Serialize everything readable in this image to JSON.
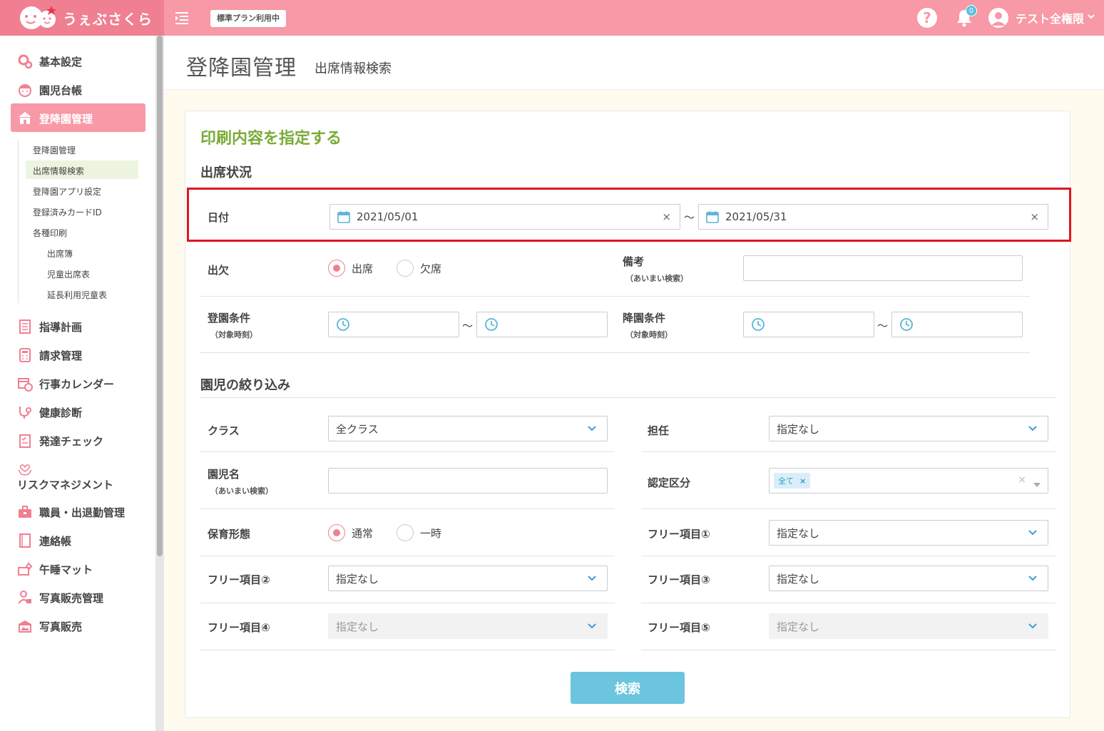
{
  "header": {
    "logo_text": "うぇぶさくら",
    "plan_badge": "標準プラン利用中",
    "help_label": "?",
    "notification_count": "0",
    "user_name": "テスト全権限",
    "brand_color": "#f799a6"
  },
  "sidebar": {
    "items": [
      {
        "label": "基本設定",
        "icon": "gear-icon"
      },
      {
        "label": "園児台帳",
        "icon": "child-face-icon"
      },
      {
        "label": "登降園管理",
        "icon": "school-icon"
      },
      {
        "label": "指導計画",
        "icon": "notebook-icon"
      },
      {
        "label": "請求管理",
        "icon": "calculator-icon"
      },
      {
        "label": "行事カレンダー",
        "icon": "calendar-clock-icon"
      },
      {
        "label": "健康診断",
        "icon": "stethoscope-icon"
      },
      {
        "label": "発達チェック",
        "icon": "checklist-icon"
      },
      {
        "label": "リスクマネジメント",
        "icon": "hands-heart-icon"
      },
      {
        "label": "職員・出退勤管理",
        "icon": "briefcase-icon"
      },
      {
        "label": "連絡帳",
        "icon": "book-icon"
      },
      {
        "label": "午睡マット",
        "icon": "mat-icon"
      },
      {
        "label": "写真販売管理",
        "icon": "person-photo-icon"
      },
      {
        "label": "写真販売",
        "icon": "photo-shop-icon"
      }
    ],
    "sub_items": [
      "登降園管理",
      "出席情報検索",
      "登降園アプリ設定",
      "登録済みカードID",
      "各種印刷"
    ],
    "sub_sub_items": [
      "出席簿",
      "児童出席表",
      "延長利用児童表"
    ]
  },
  "page": {
    "title": "登降園管理",
    "subtitle": "出席情報検索"
  },
  "form": {
    "card_title": "印刷内容を指定する",
    "attendance_section": "出席状況",
    "date_label": "日付",
    "date_from": "2021/05/01",
    "date_to": "2021/05/31",
    "tilde": "～",
    "clear_symbol": "×",
    "presence_label": "出欠",
    "presence_options": [
      "出席",
      "欠席"
    ],
    "presence_selected": "出席",
    "remarks_label": "備考",
    "remarks_sub": "（あいまい検索）",
    "remarks_value": "",
    "arrival_label": "登園条件",
    "arrival_sub": "（対象時刻）",
    "departure_label": "降園条件",
    "departure_sub": "（対象時刻）",
    "filter_section": "園児の絞り込み",
    "class_label": "クラス",
    "class_value": "全クラス",
    "teacher_label": "担任",
    "teacher_value": "指定なし",
    "child_name_label": "園児名",
    "child_name_sub": "（あいまい検索）",
    "child_name_value": "",
    "cert_label": "認定区分",
    "cert_tag": "全て",
    "cert_tag_remove": "×",
    "care_label": "保育形態",
    "care_options": [
      "通常",
      "一時"
    ],
    "care_selected": "通常",
    "free1_label": "フリー項目①",
    "free1_value": "指定なし",
    "free2_label": "フリー項目②",
    "free2_value": "指定なし",
    "free3_label": "フリー項目③",
    "free3_value": "指定なし",
    "free4_label": "フリー項目④",
    "free4_value": "指定なし",
    "free5_label": "フリー項目⑤",
    "free5_value": "指定なし",
    "search_button": "検索"
  }
}
